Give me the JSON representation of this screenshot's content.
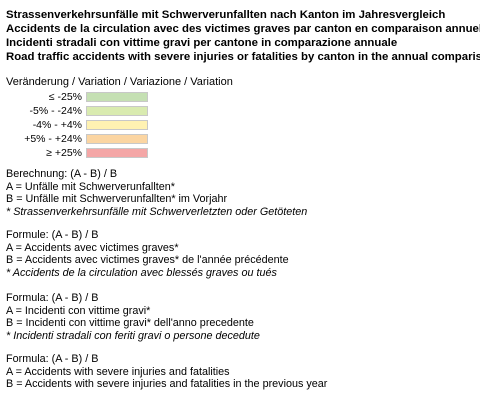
{
  "titles": [
    "Strassenverkehrsunfälle mit Schwerverunfallten  nach Kanton im Jahresvergleich",
    "Accidents de la circulation avec des victimes graves par canton en comparaison annuelle",
    "Incidenti stradali con vittime gravi per cantone in comparazione annuale",
    "Road traffic accidents with severe injuries or fatalities by canton in the annual comparision"
  ],
  "legend": {
    "title": "Veränderung / Variation / Variazione / Variation",
    "rows": [
      {
        "label": "≤  -25%",
        "color": "#c5e0b3"
      },
      {
        "label": "-5%  -  -24%",
        "color": "#d9ebb0"
      },
      {
        "label": "-4%  -   +4%",
        "color": "#fff2b2"
      },
      {
        "label": "+5%  -  +24%",
        "color": "#fbd5a2"
      },
      {
        "label": "≥  +25%",
        "color": "#f4a6a6"
      }
    ]
  },
  "blocks": {
    "de": {
      "formula": "Berechnung: (A - B) / B",
      "a": "A = Unfälle mit Schwerverunfallten*",
      "b": "B = Unfälle mit Schwerverunfallten* im Vorjahr",
      "note": "* Strassenverkehrsunfälle mit Schwerverletzten oder Getöteten"
    },
    "fr": {
      "formula": "Formule: (A - B) / B",
      "a": "A = Accidents avec victimes graves*",
      "b": "B = Accidents avec victimes graves* de l'année précédente",
      "note": "* Accidents de la circulation avec blessés graves ou tués"
    },
    "it": {
      "formula": "Formula: (A - B) / B",
      "a": "A = Incidenti con vittime gravi*",
      "b": "B = Incidenti con vittime gravi* dell'anno precedente",
      "note": "* Incidenti stradali con feriti gravi o persone decedute"
    },
    "en": {
      "formula": "Formula: (A - B) / B",
      "a": "A = Accidents with severe injuries and fatalities",
      "b": "B = Accidents with severe injuries and fatalities in the previous year"
    }
  }
}
